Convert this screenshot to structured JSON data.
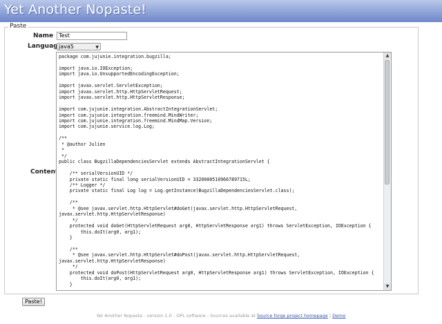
{
  "header": {
    "title": "Yet Another Nopaste!"
  },
  "form": {
    "legend": "Paste",
    "name_label": "Name",
    "name_value": "Test",
    "language_label": "Language",
    "language_value": "java5",
    "content_label": "Content",
    "content_code": "package com.jujunie.integration.bugzilla;\n\nimport java.io.IOException;\nimport java.io.UnsupportedEncodingException;\n\nimport javax.servlet.ServletException;\nimport javax.servlet.http.HttpServletRequest;\nimport javax.servlet.http.HttpServletResponse;\n\nimport com.jujunie.integration.AbstractIntegrationServlet;\nimport com.jujunie.integration.freemind.MindWriter;\nimport com.jujunie.integration.freemind.MindMap.Version;\nimport com.jujunie.service.log.Log;\n\n/**\n * @author Julien\n *\n */\npublic class BugzillaDependenciesServlet extends AbstractIntegrationServlet {\n\n    /** serialVersionUID */\n    private static final long serialVersionUID = 3320000510966789715L;\n    /** Logger */\n    private static final Log log = Log.getInstance(BugzillaDependenciesServlet.class);\n\n    /**\n     * @see javax.servlet.http.HttpServlet#doGet(javax.servlet.http.HttpServletRequest,\njavax.servlet.http.HttpServletResponse)\n     */\n    protected void doGet(HttpServletRequest arg0, HttpServletResponse arg1) throws ServletException, IOException {\n        this.doIt(arg0, arg1);\n    }\n\n    /**\n     * @see javax.servlet.http.HttpServlet#doPost(javax.servlet.http.HttpServletRequest,\njavax.servlet.http.HttpServletResponse)\n     */\n    protected void doPost(HttpServletRequest arg0, HttpServletResponse arg1) throws ServletException, IOException {\n        this.doIt(arg0, arg1);\n    }",
    "submit_label": "Paste!"
  },
  "footer": {
    "text": "Yet Another Nopaste - version 1.0 - GPL software - Sources available at",
    "link_project": "Source forge project homepage",
    "separator": "|",
    "link_demo": "Demo"
  }
}
